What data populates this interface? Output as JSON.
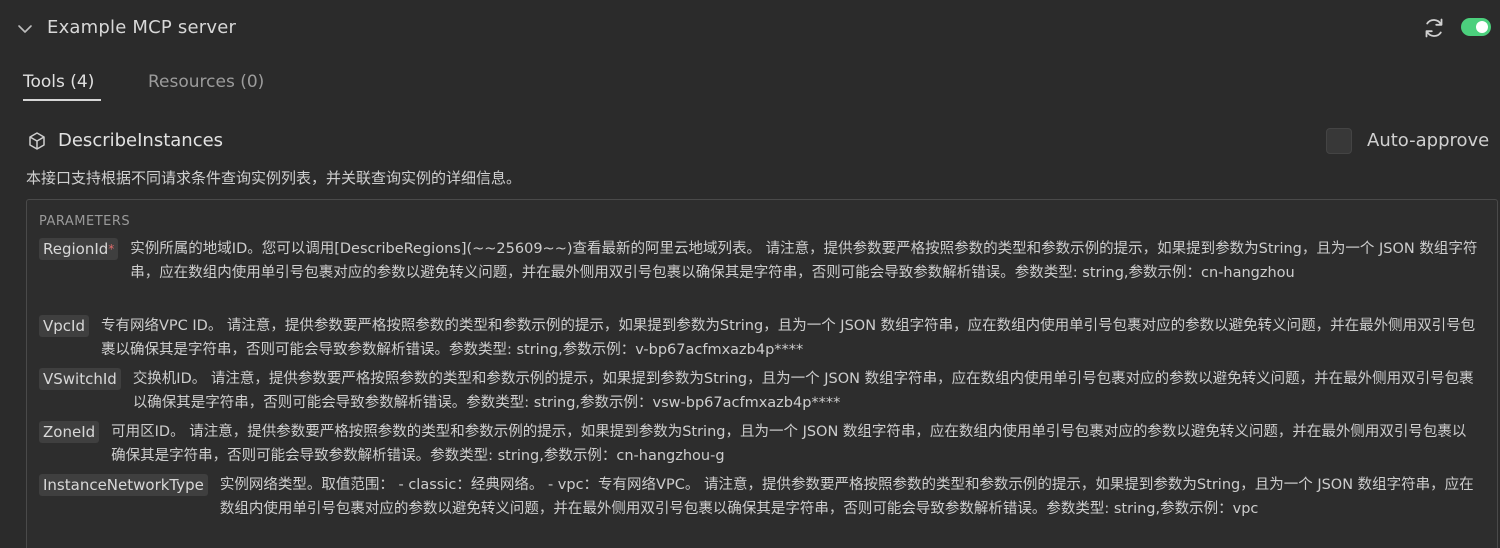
{
  "server": {
    "name": "Example MCP server",
    "enabled": true
  },
  "tabs": [
    {
      "label": "Tools (4)",
      "active": true
    },
    {
      "label": "Resources (0)",
      "active": false
    }
  ],
  "tool": {
    "name": "DescribeInstances",
    "auto_approve_label": "Auto-approve",
    "auto_approve_checked": false,
    "description": "本接口支持根据不同请求条件查询实例列表，并关联查询实例的详细信息。"
  },
  "parameters": {
    "heading": "PARAMETERS",
    "items": [
      {
        "name": "RegionId",
        "required": true,
        "required_mark": "*",
        "description": "实例所属的地域ID。您可以调用[DescribeRegions](~~25609~~)查看最新的阿里云地域列表。 请注意，提供参数要严格按照参数的类型和参数示例的提示，如果提到参数为String，且为一个 JSON 数组字符串，应在数组内使用单引号包裹对应的参数以避免转义问题，并在最外侧用双引号包裹以确保其是字符串，否则可能会导致参数解析错误。参数类型: string,参数示例：cn-hangzhou"
      },
      {
        "name": "VpcId",
        "required": false,
        "description": "专有网络VPC ID。 请注意，提供参数要严格按照参数的类型和参数示例的提示，如果提到参数为String，且为一个 JSON 数组字符串，应在数组内使用单引号包裹对应的参数以避免转义问题，并在最外侧用双引号包裹以确保其是字符串，否则可能会导致参数解析错误。参数类型: string,参数示例：v-bp67acfmxazb4p****"
      },
      {
        "name": "VSwitchId",
        "required": false,
        "description": "交换机ID。 请注意，提供参数要严格按照参数的类型和参数示例的提示，如果提到参数为String，且为一个 JSON 数组字符串，应在数组内使用单引号包裹对应的参数以避免转义问题，并在最外侧用双引号包裹以确保其是字符串，否则可能会导致参数解析错误。参数类型: string,参数示例：vsw-bp67acfmxazb4p****"
      },
      {
        "name": "ZoneId",
        "required": false,
        "description": "可用区ID。 请注意，提供参数要严格按照参数的类型和参数示例的提示，如果提到参数为String，且为一个 JSON 数组字符串，应在数组内使用单引号包裹对应的参数以避免转义问题，并在最外侧用双引号包裹以确保其是字符串，否则可能会导致参数解析错误。参数类型: string,参数示例：cn-hangzhou-g"
      },
      {
        "name": "InstanceNetworkType",
        "required": false,
        "description": "实例网络类型。取值范围： - classic：经典网络。 - vpc：专有网络VPC。 请注意，提供参数要严格按照参数的类型和参数示例的提示，如果提到参数为String，且为一个 JSON 数组字符串，应在数组内使用单引号包裹对应的参数以避免转义问题，并在最外侧用双引号包裹以确保其是字符串，否则可能会导致参数解析错误。参数类型: string,参数示例：vpc"
      }
    ]
  },
  "colors": {
    "background": "#2b2b2b",
    "toggle_on": "#4cd07d",
    "required_mark": "#e06c6c"
  },
  "icons": {
    "collapse": "chevron-down-icon",
    "refresh": "refresh-icon",
    "tool": "cube-icon"
  }
}
